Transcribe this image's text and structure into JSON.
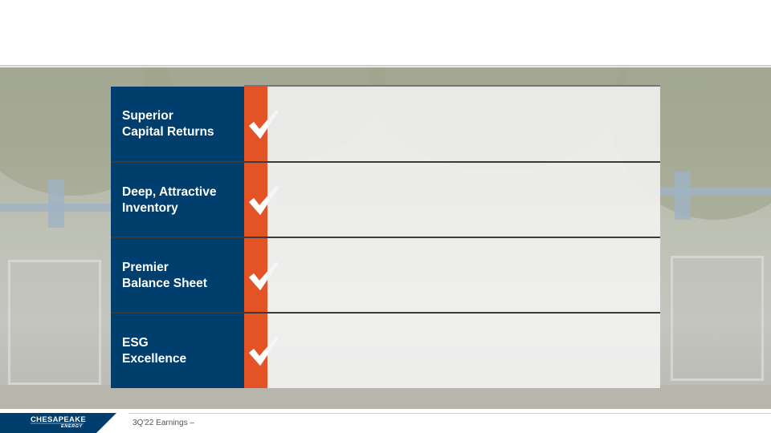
{
  "slide": {
    "rows": [
      {
        "label": "Superior\nCapital Returns",
        "icon": "checkmark-icon"
      },
      {
        "label": "Deep, Attractive\nInventory",
        "icon": "checkmark-icon"
      },
      {
        "label": "Premier\nBalance Sheet",
        "icon": "checkmark-icon"
      },
      {
        "label": "ESG\nExcellence",
        "icon": "checkmark-icon"
      }
    ]
  },
  "footer": {
    "logo_main": "CHESAPEAKE",
    "logo_sub": "ENERGY",
    "caption": "3Q'22 Earnings –"
  },
  "colors": {
    "brand_blue": "#003e6e",
    "accent_orange": "#e35325"
  }
}
